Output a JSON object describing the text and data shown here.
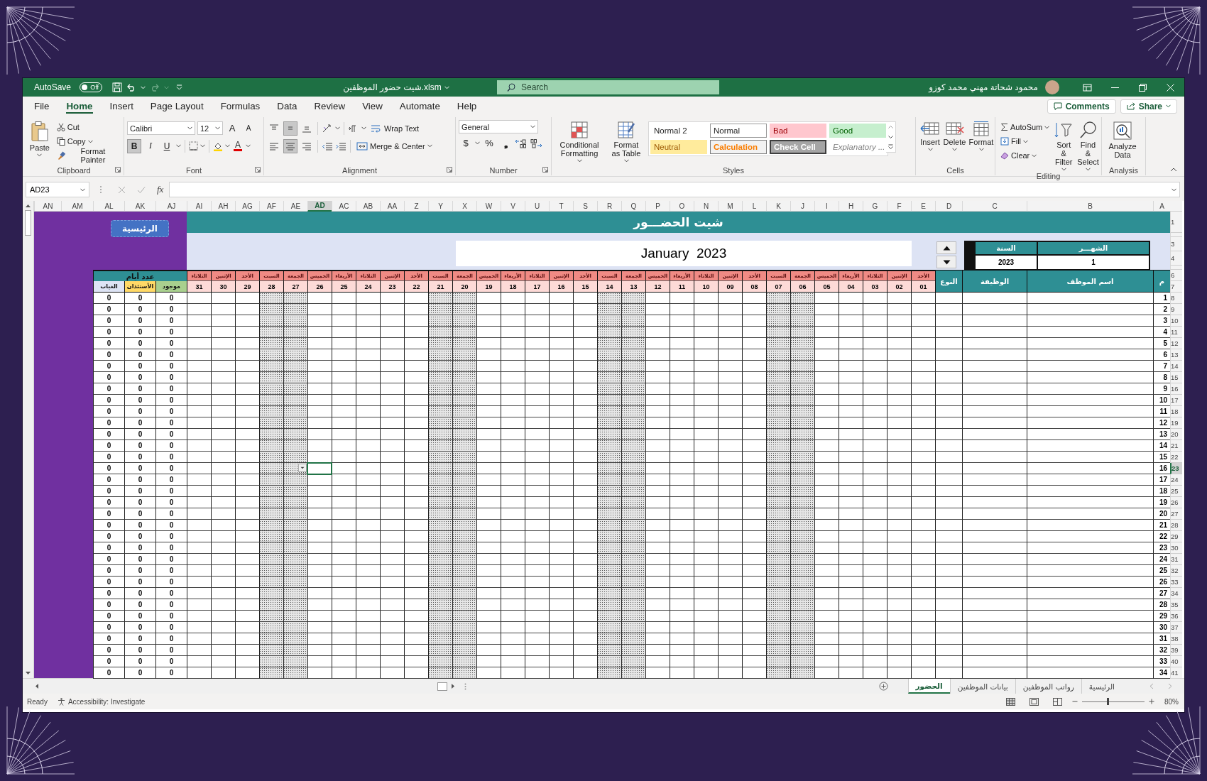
{
  "window": {
    "autosave_label": "AutoSave",
    "autosave_on": false,
    "autosave_state": "Off",
    "file_name": "شيت حضور الموظفين.xlsm",
    "search": {
      "placeholder": "Search"
    },
    "user_name": "محمود شحاتة مهني محمد كوزو"
  },
  "menu_tabs": [
    {
      "label": "Help",
      "selected": false
    },
    {
      "label": "Automate",
      "selected": false
    },
    {
      "label": "View",
      "selected": false
    },
    {
      "label": "Review",
      "selected": false
    },
    {
      "label": "Data",
      "selected": false
    },
    {
      "label": "Formulas",
      "selected": false
    },
    {
      "label": "Page Layout",
      "selected": false
    },
    {
      "label": "Insert",
      "selected": false
    },
    {
      "label": "Home",
      "selected": true
    },
    {
      "label": "File",
      "selected": false
    }
  ],
  "actions": {
    "comments": "Comments",
    "share": "Share"
  },
  "ribbon": {
    "clipboard": {
      "title": "Clipboard",
      "paste": "Paste",
      "cut": "Cut",
      "copy": "Copy",
      "format_painter": "Format Painter"
    },
    "font": {
      "title": "Font",
      "font_name": "Calibri",
      "font_size": "12",
      "grow": "A",
      "shrink": "A",
      "bold": {
        "label": "B",
        "selected": true
      },
      "italic": {
        "label": "I",
        "selected": false
      },
      "underline": {
        "label": "U",
        "selected": false
      },
      "font_color": "A"
    },
    "alignment": {
      "title": "Alignment",
      "wrap_text": "Wrap Text",
      "merge_center": "Merge & Center",
      "vertical": [
        {
          "selected": false
        },
        {
          "selected": true
        },
        {
          "selected": false
        }
      ],
      "horizontal": [
        {
          "selected": false
        },
        {
          "selected": true
        },
        {
          "selected": false
        }
      ]
    },
    "number": {
      "title": "Number",
      "format": "General",
      "currency": "$",
      "percent": "%",
      "comma": "❟"
    },
    "styles": {
      "title": "Styles",
      "conditional_formatting": "Conditional Formatting",
      "format_as_table": "Format as Table",
      "gallery": [
        {
          "label": "Good",
          "kind": "good"
        },
        {
          "label": "Bad",
          "kind": "bad"
        },
        {
          "label": "Normal",
          "kind": "normal"
        },
        {
          "label": "Normal 2",
          "kind": "normal2"
        },
        {
          "label": "Explanatory ...",
          "kind": "explanatory"
        },
        {
          "label": "Check Cell",
          "kind": "check"
        },
        {
          "label": "Calculation",
          "kind": "calculation"
        },
        {
          "label": "Neutral",
          "kind": "neutral"
        }
      ]
    },
    "cells": {
      "title": "Cells",
      "insert": "Insert",
      "delete": "Delete",
      "format": "Format"
    },
    "editing": {
      "title": "Editing",
      "autosum": "AutoSum",
      "fill": "Fill",
      "clear": "Clear",
      "sort_filter": "Sort & Filter",
      "find_select": "Find & Select"
    },
    "analysis": {
      "title": "Analysis",
      "analyze_data": "Analyze Data"
    }
  },
  "formula_bar": {
    "name_box": "AD23",
    "fx": "fx"
  },
  "sheet": {
    "columns": [
      {
        "label": "A",
        "selected": false
      },
      {
        "label": "B",
        "selected": false
      },
      {
        "label": "C",
        "selected": false
      },
      {
        "label": "D",
        "selected": false
      },
      {
        "label": "E",
        "selected": false
      },
      {
        "label": "F",
        "selected": false
      },
      {
        "label": "G",
        "selected": false
      },
      {
        "label": "H",
        "selected": false
      },
      {
        "label": "I",
        "selected": false
      },
      {
        "label": "J",
        "selected": false
      },
      {
        "label": "K",
        "selected": false
      },
      {
        "label": "L",
        "selected": false
      },
      {
        "label": "M",
        "selected": false
      },
      {
        "label": "N",
        "selected": false
      },
      {
        "label": "O",
        "selected": false
      },
      {
        "label": "P",
        "selected": false
      },
      {
        "label": "Q",
        "selected": false
      },
      {
        "label": "R",
        "selected": false
      },
      {
        "label": "S",
        "selected": false
      },
      {
        "label": "T",
        "selected": false
      },
      {
        "label": "U",
        "selected": false
      },
      {
        "label": "V",
        "selected": false
      },
      {
        "label": "W",
        "selected": false
      },
      {
        "label": "X",
        "selected": false
      },
      {
        "label": "Y",
        "selected": false
      },
      {
        "label": "Z",
        "selected": false
      },
      {
        "label": "AA",
        "selected": false
      },
      {
        "label": "AB",
        "selected": false
      },
      {
        "label": "AC",
        "selected": false
      },
      {
        "label": "AD",
        "selected": true
      },
      {
        "label": "AE",
        "selected": false
      },
      {
        "label": "AF",
        "selected": false
      },
      {
        "label": "AG",
        "selected": false
      },
      {
        "label": "AH",
        "selected": false
      },
      {
        "label": "AI",
        "selected": false
      },
      {
        "label": "AJ",
        "selected": false
      },
      {
        "label": "AK",
        "selected": false
      },
      {
        "label": "AL",
        "selected": false
      },
      {
        "label": "AM",
        "selected": false
      },
      {
        "label": "AN",
        "selected": false
      }
    ],
    "top_rows": [
      {
        "label": "1"
      },
      {
        "label": "3"
      },
      {
        "label": "4"
      },
      {
        "label": "6"
      },
      {
        "label": "7"
      }
    ],
    "title": "شيت الحضـــور",
    "home_button": "الرئيسية",
    "month_box": "January  2023",
    "period": {
      "month_label": "الشهـــر",
      "month": "1",
      "year_label": "السنة",
      "year": "2023"
    },
    "headers": {
      "serial": "م",
      "name": "اسم الموظف",
      "job": "الوظيفة",
      "type": "النوع",
      "days_count": "عدد أيام"
    },
    "summary_columns": [
      {
        "label": "موجود",
        "color": "#a9d08e"
      },
      {
        "label": "الأستئذان",
        "color": "#ffd966"
      },
      {
        "label": "الغياب",
        "color": "#dde3f4"
      }
    ],
    "days": [
      {
        "name": "الأحد",
        "day": "01",
        "weekend": false
      },
      {
        "name": "الإثنين",
        "day": "02",
        "weekend": false
      },
      {
        "name": "الثلاثاء",
        "day": "03",
        "weekend": false
      },
      {
        "name": "الأربعاء",
        "day": "04",
        "weekend": false
      },
      {
        "name": "الخميس",
        "day": "05",
        "weekend": false
      },
      {
        "name": "الجمعة",
        "day": "06",
        "weekend": true
      },
      {
        "name": "السبت",
        "day": "07",
        "weekend": true
      },
      {
        "name": "الأحد",
        "day": "08",
        "weekend": false
      },
      {
        "name": "الإثنين",
        "day": "09",
        "weekend": false
      },
      {
        "name": "الثلاثاء",
        "day": "10",
        "weekend": false
      },
      {
        "name": "الأربعاء",
        "day": "11",
        "weekend": false
      },
      {
        "name": "الخميس",
        "day": "12",
        "weekend": false
      },
      {
        "name": "الجمعة",
        "day": "13",
        "weekend": true
      },
      {
        "name": "السبت",
        "day": "14",
        "weekend": true
      },
      {
        "name": "الأحد",
        "day": "15",
        "weekend": false
      },
      {
        "name": "الإثنين",
        "day": "16",
        "weekend": false
      },
      {
        "name": "الثلاثاء",
        "day": "17",
        "weekend": false
      },
      {
        "name": "الأربعاء",
        "day": "18",
        "weekend": false
      },
      {
        "name": "الخميس",
        "day": "19",
        "weekend": false
      },
      {
        "name": "الجمعة",
        "day": "20",
        "weekend": true
      },
      {
        "name": "السبت",
        "day": "21",
        "weekend": true
      },
      {
        "name": "الأحد",
        "day": "22",
        "weekend": false
      },
      {
        "name": "الإثنين",
        "day": "23",
        "weekend": false
      },
      {
        "name": "الثلاثاء",
        "day": "24",
        "weekend": false
      },
      {
        "name": "الأربعاء",
        "day": "25",
        "weekend": false
      },
      {
        "name": "الخميس",
        "day": "26",
        "weekend": false
      },
      {
        "name": "الجمعة",
        "day": "27",
        "weekend": true
      },
      {
        "name": "السبت",
        "day": "28",
        "weekend": true
      },
      {
        "name": "الأحد",
        "day": "29",
        "weekend": false
      },
      {
        "name": "الإثنين",
        "day": "30",
        "weekend": false
      },
      {
        "name": "الثلاثاء",
        "day": "31",
        "weekend": false
      }
    ],
    "rows": [
      {
        "row_header": "8",
        "serial": "1",
        "selected": false,
        "counts": [
          "0",
          "0",
          "0"
        ]
      },
      {
        "row_header": "9",
        "serial": "2",
        "selected": false,
        "counts": [
          "0",
          "0",
          "0"
        ]
      },
      {
        "row_header": "10",
        "serial": "3",
        "selected": false,
        "counts": [
          "0",
          "0",
          "0"
        ]
      },
      {
        "row_header": "11",
        "serial": "4",
        "selected": false,
        "counts": [
          "0",
          "0",
          "0"
        ]
      },
      {
        "row_header": "12",
        "serial": "5",
        "selected": false,
        "counts": [
          "0",
          "0",
          "0"
        ]
      },
      {
        "row_header": "13",
        "serial": "6",
        "selected": false,
        "counts": [
          "0",
          "0",
          "0"
        ]
      },
      {
        "row_header": "14",
        "serial": "7",
        "selected": false,
        "counts": [
          "0",
          "0",
          "0"
        ]
      },
      {
        "row_header": "15",
        "serial": "8",
        "selected": false,
        "counts": [
          "0",
          "0",
          "0"
        ]
      },
      {
        "row_header": "16",
        "serial": "9",
        "selected": false,
        "counts": [
          "0",
          "0",
          "0"
        ]
      },
      {
        "row_header": "17",
        "serial": "10",
        "selected": false,
        "counts": [
          "0",
          "0",
          "0"
        ]
      },
      {
        "row_header": "18",
        "serial": "11",
        "selected": false,
        "counts": [
          "0",
          "0",
          "0"
        ]
      },
      {
        "row_header": "19",
        "serial": "12",
        "selected": false,
        "counts": [
          "0",
          "0",
          "0"
        ]
      },
      {
        "row_header": "20",
        "serial": "13",
        "selected": false,
        "counts": [
          "0",
          "0",
          "0"
        ]
      },
      {
        "row_header": "21",
        "serial": "14",
        "selected": false,
        "counts": [
          "0",
          "0",
          "0"
        ]
      },
      {
        "row_header": "22",
        "serial": "15",
        "selected": false,
        "counts": [
          "0",
          "0",
          "0"
        ]
      },
      {
        "row_header": "23",
        "serial": "16",
        "selected": true,
        "counts": [
          "0",
          "0",
          "0"
        ]
      },
      {
        "row_header": "24",
        "serial": "17",
        "selected": false,
        "counts": [
          "0",
          "0",
          "0"
        ]
      },
      {
        "row_header": "25",
        "serial": "18",
        "selected": false,
        "counts": [
          "0",
          "0",
          "0"
        ]
      },
      {
        "row_header": "26",
        "serial": "19",
        "selected": false,
        "counts": [
          "0",
          "0",
          "0"
        ]
      },
      {
        "row_header": "27",
        "serial": "20",
        "selected": false,
        "counts": [
          "0",
          "0",
          "0"
        ]
      },
      {
        "row_header": "28",
        "serial": "21",
        "selected": false,
        "counts": [
          "0",
          "0",
          "0"
        ]
      },
      {
        "row_header": "29",
        "serial": "22",
        "selected": false,
        "counts": [
          "0",
          "0",
          "0"
        ]
      },
      {
        "row_header": "30",
        "serial": "23",
        "selected": false,
        "counts": [
          "0",
          "0",
          "0"
        ]
      },
      {
        "row_header": "31",
        "serial": "24",
        "selected": false,
        "counts": [
          "0",
          "0",
          "0"
        ]
      },
      {
        "row_header": "32",
        "serial": "25",
        "selected": false,
        "counts": [
          "0",
          "0",
          "0"
        ]
      },
      {
        "row_header": "33",
        "serial": "26",
        "selected": false,
        "counts": [
          "0",
          "0",
          "0"
        ]
      },
      {
        "row_header": "34",
        "serial": "27",
        "selected": false,
        "counts": [
          "0",
          "0",
          "0"
        ]
      },
      {
        "row_header": "35",
        "serial": "28",
        "selected": false,
        "counts": [
          "0",
          "0",
          "0"
        ]
      },
      {
        "row_header": "36",
        "serial": "29",
        "selected": false,
        "counts": [
          "0",
          "0",
          "0"
        ]
      },
      {
        "row_header": "37",
        "serial": "30",
        "selected": false,
        "counts": [
          "0",
          "0",
          "0"
        ]
      },
      {
        "row_header": "38",
        "serial": "31",
        "selected": false,
        "counts": [
          "0",
          "0",
          "0"
        ]
      },
      {
        "row_header": "39",
        "serial": "32",
        "selected": false,
        "counts": [
          "0",
          "0",
          "0"
        ]
      },
      {
        "row_header": "40",
        "serial": "33",
        "selected": false,
        "counts": [
          "0",
          "0",
          "0"
        ]
      },
      {
        "row_header": "41",
        "serial": "34",
        "selected": false,
        "counts": [
          "0",
          "0",
          "0"
        ]
      }
    ]
  },
  "sheet_tabs": [
    {
      "label": "الرئيسية",
      "selected": false
    },
    {
      "label": "رواتب الموظفين",
      "selected": false
    },
    {
      "label": "بيانات الموظفين",
      "selected": false
    },
    {
      "label": "الحضور",
      "selected": true
    }
  ],
  "status_bar": {
    "ready": "Ready",
    "accessibility": "Accessibility: Investigate",
    "zoom": {
      "level": 0.42,
      "label": "80%"
    }
  }
}
